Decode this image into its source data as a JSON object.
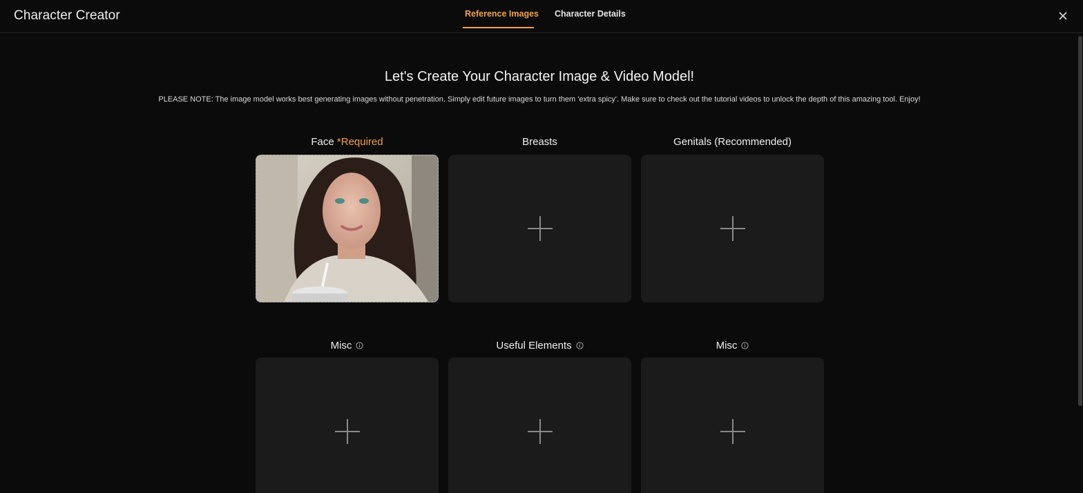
{
  "header": {
    "title": "Character Creator",
    "tabs": [
      {
        "label": "Reference Images",
        "active": true
      },
      {
        "label": "Character Details",
        "active": false
      }
    ],
    "accent_color": "#f2a245"
  },
  "main": {
    "heading": "Let's Create Your Character Image & Video Model!",
    "note": "PLEASE NOTE: The image model works best generating images without penetration. Simply edit future images to turn them 'extra spicy'. Make sure to check out the tutorial videos to unlock the depth of this amazing tool. Enjoy!",
    "slots": [
      {
        "label": "Face",
        "required_text": "*Required",
        "filled": true,
        "icon": "photo-thumbnail"
      },
      {
        "label": "Breasts",
        "filled": false,
        "icon": "plus-icon"
      },
      {
        "label": "Genitals (Recommended)",
        "filled": false,
        "icon": "plus-icon"
      },
      {
        "label": "Misc",
        "info": true,
        "filled": false,
        "icon": "plus-icon"
      },
      {
        "label": "Useful Elements",
        "info": true,
        "filled": false,
        "icon": "plus-icon"
      },
      {
        "label": "Misc",
        "info": true,
        "filled": false,
        "icon": "plus-icon"
      }
    ]
  }
}
